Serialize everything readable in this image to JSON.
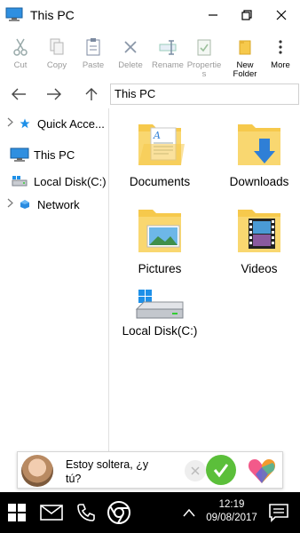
{
  "window": {
    "title": "This PC"
  },
  "ribbon": {
    "cut": "Cut",
    "copy": "Copy",
    "paste": "Paste",
    "delete": "Delete",
    "rename": "Rename",
    "properties": "Propertie\ns",
    "new_folder": "New\nFolder",
    "more": "More"
  },
  "address": {
    "path": "This PC"
  },
  "sidebar": {
    "items": [
      {
        "label": "Quick Acce...",
        "icon": "star-icon",
        "expandable": true
      },
      {
        "label": "This PC",
        "icon": "computer-icon",
        "expandable": false
      },
      {
        "label": "Local Disk(C:)",
        "icon": "drive-icon",
        "expandable": false
      },
      {
        "label": "Network",
        "icon": "network-icon",
        "expandable": true
      }
    ]
  },
  "content": {
    "items": [
      {
        "label": "Documents",
        "icon": "documents-folder-icon"
      },
      {
        "label": "Downloads",
        "icon": "downloads-folder-icon"
      },
      {
        "label": "Pictures",
        "icon": "pictures-folder-icon"
      },
      {
        "label": "Videos",
        "icon": "videos-folder-icon"
      },
      {
        "label": "Local Disk(C:)",
        "icon": "drive-icon"
      }
    ]
  },
  "notification": {
    "message": "Estoy soltera, ¿y\ntú?"
  },
  "taskbar": {
    "time": "12:19",
    "date": "09/08/2017"
  },
  "colors": {
    "folder": "#f6c94c",
    "accent": "#2f7fd6",
    "taskbar": "#000000",
    "accept": "#5bbf3a"
  }
}
